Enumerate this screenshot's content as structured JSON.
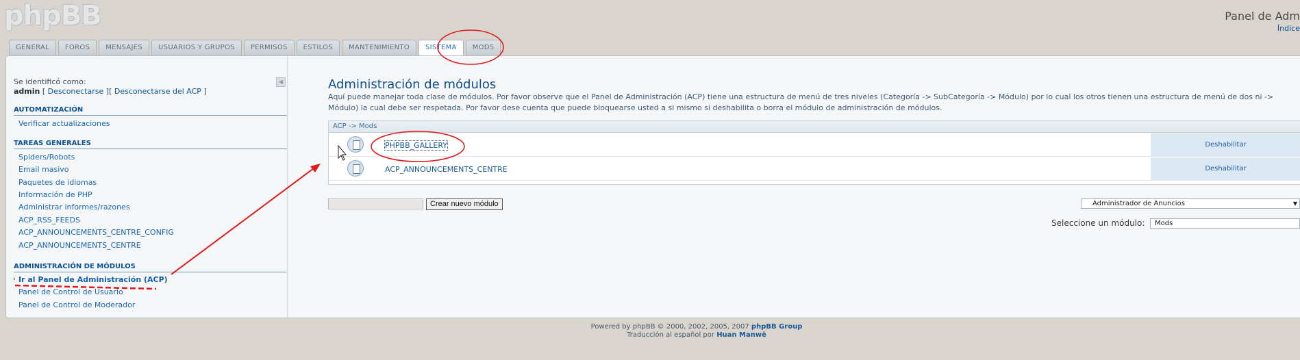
{
  "brand": {
    "logo": "phpBB"
  },
  "header": {
    "title": "Panel de Adm",
    "index_link": "Índice"
  },
  "tabs": [
    {
      "label": "GENERAL"
    },
    {
      "label": "FOROS"
    },
    {
      "label": "MENSAJES"
    },
    {
      "label": "USUARIOS Y GRUPOS"
    },
    {
      "label": "PERMISOS"
    },
    {
      "label": "ESTILOS"
    },
    {
      "label": "MANTENIMIENTO"
    },
    {
      "label": "SISTEMA",
      "active": true
    },
    {
      "label": "MODS"
    }
  ],
  "sidebar": {
    "logged_as": "Se identificó como:",
    "username": "admin",
    "logout": "Desconectarse",
    "logout_acp": "Desconectarse  del ACP",
    "bracket_open": "[",
    "bracket_mid": "][",
    "bracket_close": "]",
    "collapse_glyph": "◀",
    "sections": [
      {
        "title": "AUTOMATIZACIÓN",
        "items": [
          "Verificar actualizaciones"
        ]
      },
      {
        "title": "TAREAS GENERALES",
        "items": [
          "Spiders/Robots",
          "Email masivo",
          "Paquetes de idiomas",
          "Información de PHP",
          "Administrar informes/razones",
          "ACP_RSS_FEEDS",
          "ACP_ANNOUNCEMENTS_CENTRE_CONFIG",
          "ACP_ANNOUNCEMENTS_CENTRE"
        ]
      },
      {
        "title": "ADMINISTRACIÓN DE MÓDULOS",
        "items": [
          "Ir al Panel de Administración (ACP)",
          "Panel de Control de Usuario",
          "Panel de Control de Moderador"
        ]
      }
    ]
  },
  "main": {
    "title": "Administración de módulos",
    "description": "Aquí puede manejar toda clase de módulos. Por favor observe que el Panel de Administración (ACP) tiene una estructura de menú de tres niveles (Categoría -> SubCategoría -> Módulo) por lo cual los otros tienen una estructura de menú de dos ni -> Módulo) la cual debe ser respetada. Por favor dese cuenta que puede bloquearse usted a si mismo si deshabilita o borra el módulo de administración de módulos.",
    "breadcrumb": "ACP -> Mods",
    "modules": [
      {
        "name": "PHPBB_GALLERY",
        "action": "Deshabilitar"
      },
      {
        "name": "ACP_ANNOUNCEMENTS_CENTRE",
        "action": "Deshabilitar"
      }
    ],
    "new_module_value": "",
    "new_module_button": "Crear nuevo módulo",
    "admin_select_value": "Administrador de Anuncios",
    "select_module_label": "Seleccione un módulo:",
    "select_module_value": "Mods"
  },
  "footer": {
    "powered_prefix": "Powered by phpBB © 2000, 2002, 2005, 2007",
    "powered_group": "phpBB Group",
    "translation_prefix": "Traducción al español por",
    "translator": "Huan Manwë"
  },
  "colors": {
    "annotation_red": "#e01a1a",
    "link_blue": "#0b5394",
    "background": "#d9d4ce"
  }
}
